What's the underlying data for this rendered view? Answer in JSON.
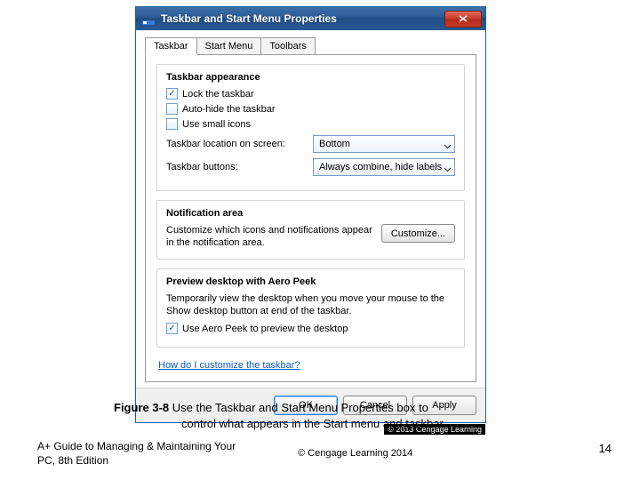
{
  "dialog": {
    "title": "Taskbar and Start Menu Properties",
    "tabs": {
      "taskbar": "Taskbar",
      "startmenu": "Start Menu",
      "toolbars": "Toolbars"
    },
    "appearance": {
      "title": "Taskbar appearance",
      "lock": "Lock the taskbar",
      "autohide": "Auto-hide the taskbar",
      "smallicons": "Use small icons",
      "location_label": "Taskbar location on screen:",
      "location_value": "Bottom",
      "buttons_label": "Taskbar buttons:",
      "buttons_value": "Always combine, hide labels"
    },
    "notification": {
      "title": "Notification area",
      "text": "Customize which icons and notifications appear in the notification area.",
      "customize": "Customize..."
    },
    "aeropeek": {
      "title": "Preview desktop with Aero Peek",
      "text": "Temporarily view the desktop when you move your mouse to the Show desktop button at end of the taskbar.",
      "check": "Use Aero Peek to preview the desktop"
    },
    "help_link": "How do I customize the taskbar?",
    "buttons": {
      "ok": "OK",
      "cancel": "Cancel",
      "apply": "Apply"
    },
    "credit": "© 2013 Cengage Learning"
  },
  "caption": {
    "label": "Figure 3-8",
    "text1": " Use the Taskbar and Start Menu Properties box to",
    "text2": "control what appears in the Start menu and taskbar"
  },
  "footer": {
    "book": "A+ Guide to Managing & Maintaining Your PC, 8th Edition",
    "copyright": "© Cengage Learning  2014",
    "page": "14"
  }
}
